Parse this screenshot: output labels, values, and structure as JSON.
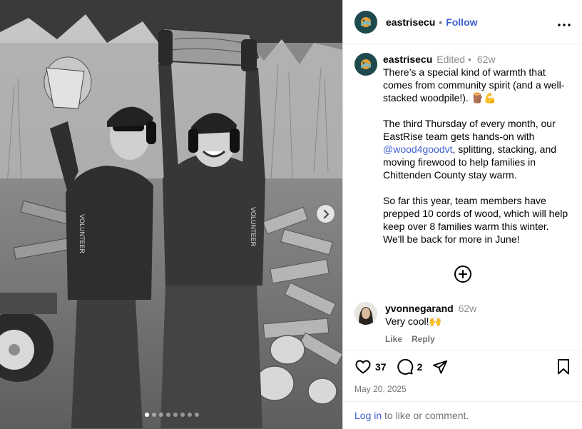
{
  "post": {
    "username": "eastrisecu",
    "separator": "•",
    "follow_label": "Follow",
    "more_icon": "more-horizontal-icon",
    "edited_label": "Edited",
    "meta_dot": "•",
    "time": "62w",
    "caption_p1": "There’s a special kind of warmth that comes from community spirit (and a well-stacked woodpile!). 🪵💪",
    "caption_p2_before": "The third Thursday of every month, our EastRise team gets hands-on with ",
    "caption_mention": "@wood4goodvt",
    "caption_p2_after": ", splitting, stacking, and moving firewood to help families in Chittenden County stay warm.",
    "caption_p3": "So far this year, team members have prepped 10 cords of wood, which will help keep over 8 families warm this winter. We'll be back for more in June!",
    "load_more_icon": "plus-circle-icon",
    "date": "May 20, 2025"
  },
  "comment": {
    "username": "yvonnegarand",
    "time": "62w",
    "text": "Very cool!🙌",
    "like_label": "Like",
    "reply_label": "Reply"
  },
  "actions": {
    "likes": "37",
    "comments": "2"
  },
  "login": {
    "link": "Log in",
    "rest": " to like or comment."
  },
  "carousel": {
    "slide_count": 8,
    "active_index": 0
  },
  "colors": {
    "link": "#3f5fd1",
    "muted": "#737373",
    "brand_avatar": "#1f4a4d",
    "brand_accent": "#e0a13a"
  }
}
